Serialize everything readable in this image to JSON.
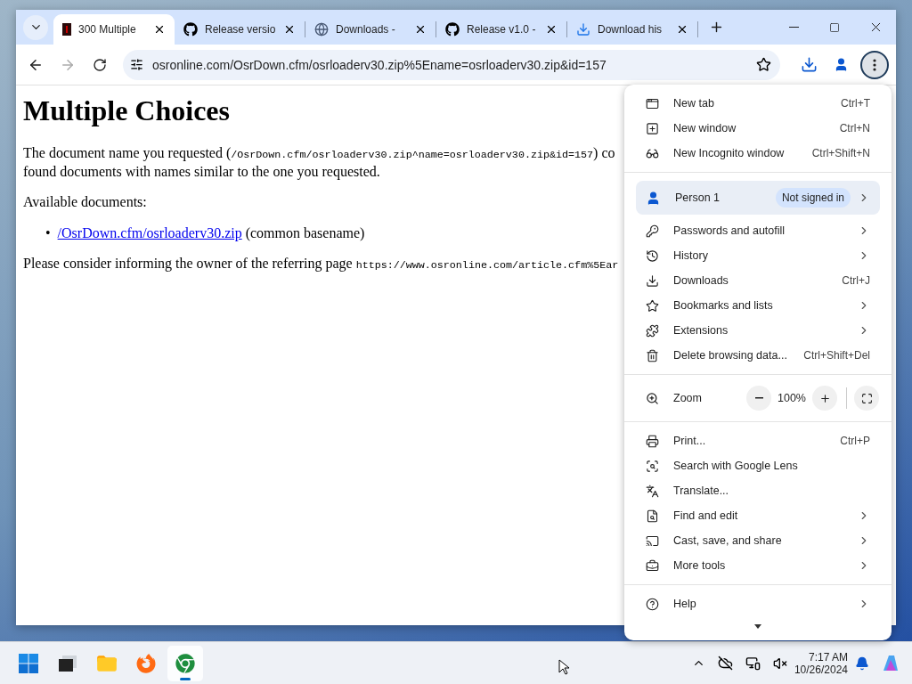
{
  "tabs": [
    {
      "title": "300 Multiple",
      "selected": true
    },
    {
      "title": "Release versio",
      "selected": false
    },
    {
      "title": "Downloads -",
      "selected": false
    },
    {
      "title": "Release v1.0 -",
      "selected": false
    },
    {
      "title": "Download his",
      "selected": false
    }
  ],
  "address_bar": {
    "url": "osronline.com/OsrDown.cfm/osrloaderv30.zip%5Ename=osrloaderv30.zip&id=157"
  },
  "page": {
    "heading": "Multiple Choices",
    "intro_lines": [
      [
        {
          "kind": "text",
          "text": "The document name you requested ("
        },
        {
          "kind": "code",
          "text": "/OsrDown.cfm/osrloaderv30.zip^name=osrloaderv30.zip&id=157"
        },
        {
          "kind": "text",
          "text": ") co"
        }
      ],
      [
        {
          "kind": "text",
          "text": "found documents with names similar to the one you requested."
        }
      ]
    ],
    "available_label": "Available documents:",
    "documents": [
      {
        "bullet": "•",
        "link": "/OsrDown.cfm/osrloaderv30.zip",
        "note": "(common basename)"
      }
    ],
    "referrer": [
      {
        "kind": "text",
        "text": "Please consider informing the owner of the referring page "
      },
      {
        "kind": "code",
        "text": "https://www.osronline.com/article.cfm%5Ear"
      }
    ]
  },
  "menu": {
    "sections": [
      [
        {
          "kind": "command",
          "label": "New tab",
          "shortcut": "Ctrl+T",
          "submenu": false
        },
        {
          "kind": "command",
          "label": "New window",
          "shortcut": "Ctrl+N",
          "submenu": false
        },
        {
          "kind": "command",
          "label": "New Incognito window",
          "shortcut": "Ctrl+Shift+N",
          "submenu": false
        }
      ],
      [
        {
          "kind": "profile",
          "label": "Person 1",
          "badge": "Not signed in",
          "submenu": true
        },
        {
          "kind": "command",
          "label": "Passwords and autofill",
          "submenu": true
        },
        {
          "kind": "command",
          "label": "History",
          "submenu": true
        },
        {
          "kind": "command",
          "label": "Downloads",
          "shortcut": "Ctrl+J",
          "submenu": false
        },
        {
          "kind": "command",
          "label": "Bookmarks and lists",
          "submenu": true
        },
        {
          "kind": "command",
          "label": "Extensions",
          "submenu": true
        },
        {
          "kind": "command",
          "label": "Delete browsing data...",
          "shortcut": "Ctrl+Shift+Del",
          "submenu": false
        }
      ],
      [
        {
          "kind": "zoom",
          "label": "Zoom",
          "value": "100%",
          "submenu": false
        }
      ],
      [
        {
          "kind": "command",
          "label": "Print...",
          "shortcut": "Ctrl+P",
          "submenu": false
        },
        {
          "kind": "command",
          "label": "Search with Google Lens",
          "submenu": false
        },
        {
          "kind": "command",
          "label": "Translate...",
          "submenu": false
        },
        {
          "kind": "command",
          "label": "Find and edit",
          "submenu": true
        },
        {
          "kind": "command",
          "label": "Cast, save, and share",
          "submenu": true
        },
        {
          "kind": "command",
          "label": "More tools",
          "submenu": true
        }
      ],
      [
        {
          "kind": "command",
          "label": "Help",
          "submenu": true
        }
      ]
    ]
  },
  "taskbar": {
    "apps": [
      {
        "selected": false
      },
      {
        "selected": false
      },
      {
        "selected": false
      },
      {
        "selected": false
      },
      {
        "selected": true
      }
    ],
    "time": "7:17 AM",
    "date": "10/26/2024"
  }
}
